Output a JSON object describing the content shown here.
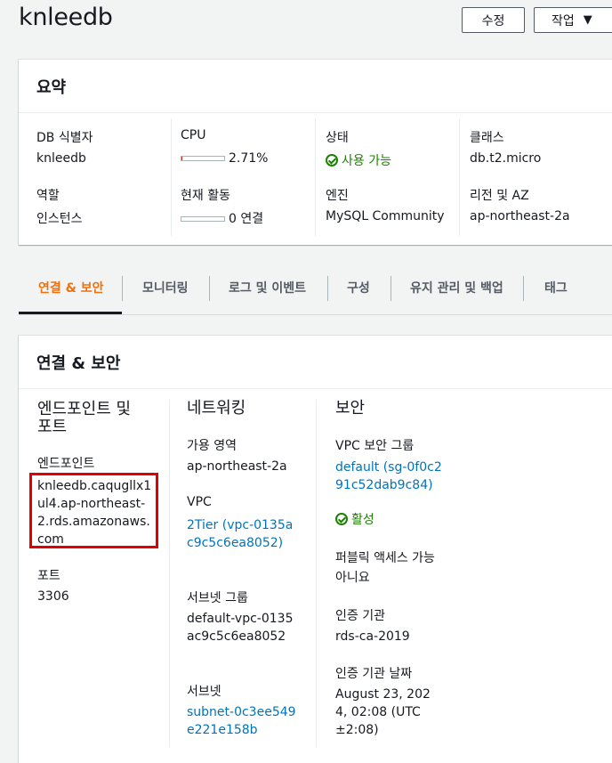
{
  "header": {
    "title": "knleedb",
    "edit_label": "수정",
    "actions_label": "작업"
  },
  "summary": {
    "title": "요약",
    "db_id_label": "DB 식별자",
    "db_id": "knleedb",
    "role_label": "역할",
    "role": "인스턴스",
    "cpu_label": "CPU",
    "cpu_value": "2.71%",
    "cpu_fraction": 0.0271,
    "activity_label": "현재 활동",
    "activity_value": "0 연결",
    "activity_fraction": 0,
    "status_label": "상태",
    "status_value": "사용 가능",
    "engine_label": "엔진",
    "engine_value": "MySQL Community",
    "class_label": "클래스",
    "class_value": "db.t2.micro",
    "region_label": "리전 및 AZ",
    "region_value": "ap-northeast-2a"
  },
  "tabs": {
    "conn": "연결 & 보안",
    "monitoring": "모니터링",
    "logs": "로그 및 이벤트",
    "config": "구성",
    "maintenance": "유지 관리 및 백업",
    "tags": "태그"
  },
  "connectivity": {
    "title": "연결 & 보안",
    "endpoint_section_line1": "엔드포인트 및",
    "endpoint_section_line2": "포트",
    "endpoint_label": "엔드포인트",
    "endpoint_value": "knleedb.caqugllx1ul4.ap-northeast-2.rds.amazonaws.com",
    "port_label": "포트",
    "port_value": "3306",
    "network_section": "네트워킹",
    "az_label": "가용 영역",
    "az_value": "ap-northeast-2a",
    "vpc_label": "VPC",
    "vpc_value": "2Tier (vpc-0135ac9c5c6ea8052)",
    "subnet_group_label": "서브넷 그룹",
    "subnet_group_value": "default-vpc-0135ac9c5c6ea8052",
    "subnet_label": "서브넷",
    "subnet_value": "subnet-0c3ee549e221e158b",
    "security_section": "보안",
    "sg_label": "VPC 보안 그룹",
    "sg_value": "default (sg-0f0c291c52dab9c84)",
    "sg_status": "활성",
    "public_label": "퍼블릭 액세스 가능",
    "public_value": "아니요",
    "ca_label": "인증 기관",
    "ca_value": "rds-ca-2019",
    "ca_date_label": "인증 기관 날짜",
    "ca_date_value": "August 23, 2024, 02:08 (UTC±2:08)"
  }
}
